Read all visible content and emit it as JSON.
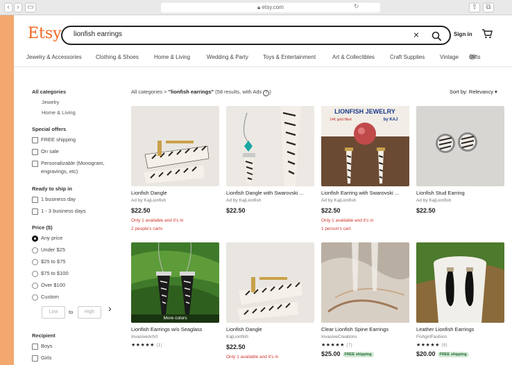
{
  "browser": {
    "url": "etsy.com"
  },
  "header": {
    "logo": "Etsy",
    "search_value": "lionfish earrings",
    "sign_in": "Sign in"
  },
  "catnav": [
    "Jewelry & Accessories",
    "Clothing & Shoes",
    "Home & Living",
    "Wedding & Party",
    "Toys & Entertainment",
    "Art & Collectibles",
    "Craft Supplies",
    "Vintage",
    "Gifts"
  ],
  "sidebar": {
    "all_categories": "All categories",
    "cat_links": [
      "Jewelry",
      "Home & Living"
    ],
    "special_offers": "Special offers",
    "offers": [
      "FREE shipping",
      "On sale",
      "Personalizable (Monogram,",
      "engravings, etc)"
    ],
    "ready_to_ship": "Ready to ship in",
    "ship_options": [
      "1 business day",
      "1 - 3 business days"
    ],
    "price": "Price ($)",
    "price_options": [
      "Any price",
      "Under $25",
      "$25 to $75",
      "$75 to $100",
      "Over $100",
      "Custom"
    ],
    "low": "Low",
    "to": "to",
    "high": "High",
    "recipient": "Recipient",
    "recipient_options": [
      "Boys",
      "Girls"
    ]
  },
  "results": {
    "crumb_root": "All categories",
    "crumb_sep": ">",
    "crumb_query": "\"lionfish earrings\"",
    "crumb_meta": "(58 results, with Ads",
    "crumb_help": "?",
    "sort": "Sort by: Relevancy"
  },
  "listings": [
    {
      "title": "Lionfish Dangle",
      "shop": "Ad by KajLionfish",
      "price": "$22.50",
      "warn1": "Only 1 available and it's in",
      "warn2": "2 people's carts"
    },
    {
      "title": "Lionfish Dangle with Swarovski ...",
      "shop": "Ad by KajLionfish",
      "price": "$22.50"
    },
    {
      "title": "Lionfish Earring with Swarovski ...",
      "shop": "Ad by KajLionfish",
      "price": "$22.50",
      "warn1": "Only 1 available and it's in",
      "warn2": "1 person's cart"
    },
    {
      "title": "Lionfish Stud Earring",
      "shop": "Ad by KajLionfish",
      "price": "$22.50"
    },
    {
      "title": "Lionfish Earrings w/o Seaglass",
      "shop": "InvasiveArtVI",
      "stars": "★★★★★",
      "count": "(1)",
      "badge": "More colors"
    },
    {
      "title": "Lionfish Dangle",
      "shop": "KajLionfish",
      "price": "$22.50",
      "warn1": "Only 1 available and it's in"
    },
    {
      "title": "Clear Lionfish Spine Earrings",
      "shop": "InvasiveCreations",
      "stars": "★★★★★",
      "count": "(7)",
      "price": "$25.00",
      "free": "FREE shipping"
    },
    {
      "title": "Leather Lionfish Earrings",
      "shop": "FishgirlFashion",
      "stars": "★★★★★",
      "count": "(8)",
      "price": "$20.00",
      "free": "FREE shipping"
    }
  ],
  "thumb3_text": {
    "line1": "LIONFISH JEWELRY",
    "line2": "14K gold filled",
    "line3": "by KAJ"
  },
  "colors": {
    "accent": "#f1641e",
    "bg_frame": "#f2a86e",
    "warn": "#d0342c"
  }
}
